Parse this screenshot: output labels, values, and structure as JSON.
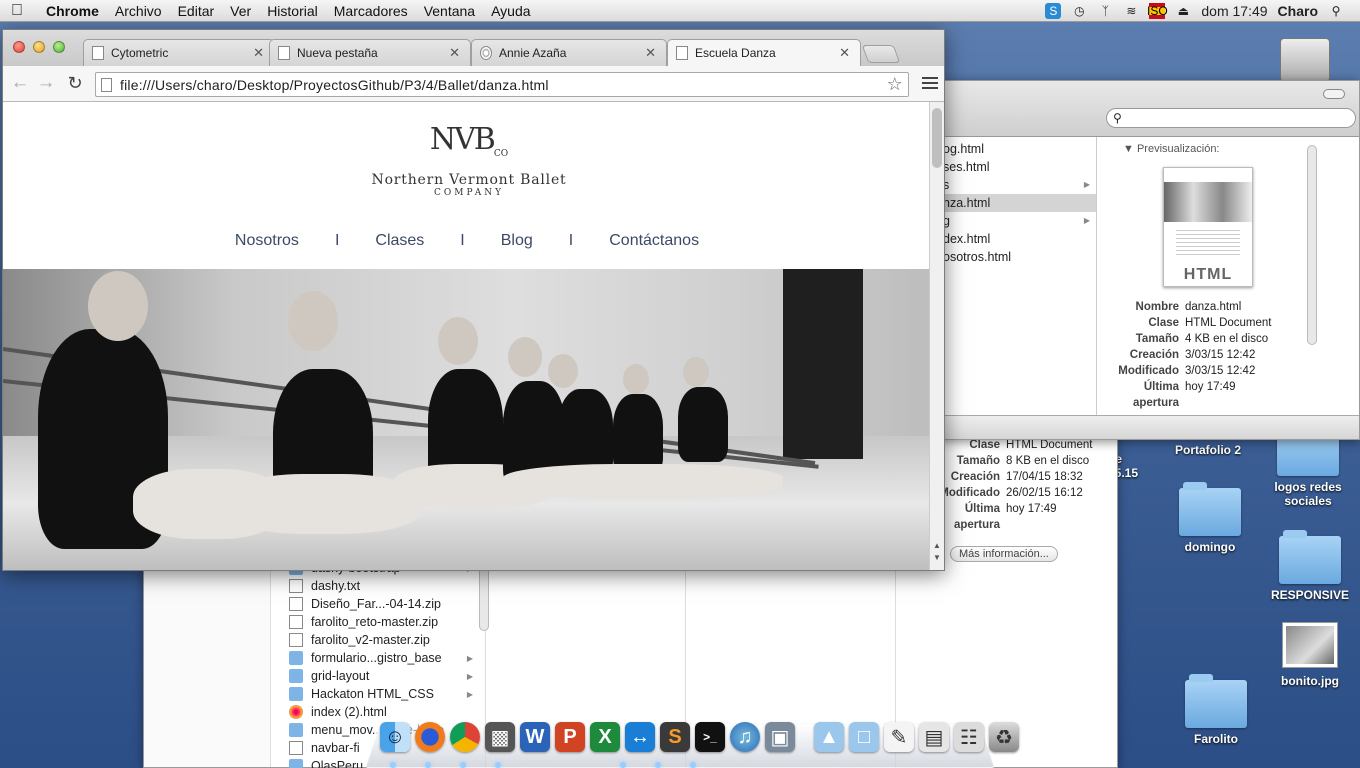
{
  "menubar": {
    "app": "Chrome",
    "items": [
      "Archivo",
      "Editar",
      "Ver",
      "Historial",
      "Marcadores",
      "Ventana",
      "Ayuda"
    ],
    "flag_text": "ISO",
    "clock": "dom 17:49",
    "user": "Charo"
  },
  "chrome": {
    "tabs": [
      {
        "title": "Cytometric",
        "icon": "page-icon"
      },
      {
        "title": "Nueva pestaña",
        "icon": "page-icon"
      },
      {
        "title": "Annie Azaña",
        "icon": "gear-icon"
      },
      {
        "title": "Escuela Danza",
        "icon": "page-icon",
        "active": true
      }
    ],
    "url": "file:///Users/charo/Desktop/ProyectosGithub/P3/4/Ballet/danza.html"
  },
  "site": {
    "logo_mark": "NVB",
    "logo_mark_small": "CO",
    "logo_name": "Northern Vermont Ballet",
    "logo_sub": "COMPANY",
    "nav": [
      "Nosotros",
      "Clases",
      "Blog",
      "Contáctanos"
    ],
    "nav_separator": "I"
  },
  "finder_top": {
    "files": [
      {
        "name": "og.html",
        "folder": false,
        "selected": false
      },
      {
        "name": "ses.html",
        "folder": false,
        "selected": false
      },
      {
        "name": "s",
        "folder": true,
        "selected": false
      },
      {
        "name": "nza.html",
        "folder": false,
        "selected": true
      },
      {
        "name": "g",
        "folder": true,
        "selected": false
      },
      {
        "name": "dex.html",
        "folder": false,
        "selected": false
      },
      {
        "name": "osotros.html",
        "folder": false,
        "selected": false
      }
    ],
    "preview_label": "Previsualización:",
    "thumb_badge": "HTML",
    "info": [
      {
        "k": "Nombre",
        "v": "danza.html"
      },
      {
        "k": "Clase",
        "v": "HTML Document"
      },
      {
        "k": "Tamaño",
        "v": "4 KB en el disco"
      },
      {
        "k": "Creación",
        "v": "3/03/15 12:42"
      },
      {
        "k": "Modificado",
        "v": "3/03/15 12:42"
      },
      {
        "k": "Última apertura",
        "v": "hoy 17:49"
      }
    ]
  },
  "finder_back": {
    "files": [
      {
        "name": "dashy-bootstrap",
        "kind": "folder"
      },
      {
        "name": "dashy.txt",
        "kind": "doc"
      },
      {
        "name": "Diseño_Far...-04-14.zip",
        "kind": "doc"
      },
      {
        "name": "farolito_reto-master.zip",
        "kind": "doc"
      },
      {
        "name": "farolito_v2-master.zip",
        "kind": "doc"
      },
      {
        "name": "formulario...gistro_base",
        "kind": "folder"
      },
      {
        "name": "grid-layout",
        "kind": "folder"
      },
      {
        "name": "Hackaton HTML_CSS",
        "kind": "folder"
      },
      {
        "name": "index (2).html",
        "kind": "html"
      },
      {
        "name": "menu_mov...gable-base",
        "kind": "folder"
      },
      {
        "name": "navbar-fi",
        "kind": "doc"
      },
      {
        "name": "OlasPeru",
        "kind": "folder"
      }
    ],
    "info": [
      {
        "k": "Clase",
        "v": "HTML Document"
      },
      {
        "k": "Tamaño",
        "v": "8 KB en el disco"
      },
      {
        "k": "Creación",
        "v": "17/04/15 18:32"
      },
      {
        "k": "Modificado",
        "v": "26/02/15 16:12"
      },
      {
        "k": "Última apertura",
        "v": "hoy 17:49"
      }
    ],
    "more_button": "Más información..."
  },
  "desktop": [
    {
      "label": "Portafolio 2",
      "kind": "folder"
    },
    {
      "label": "logos redes sociales",
      "kind": "folder"
    },
    {
      "label": "domingo",
      "kind": "folder"
    },
    {
      "label": "RESPONSIVE",
      "kind": "folder"
    },
    {
      "label": "bonito.jpg",
      "kind": "image"
    },
    {
      "label": "Farolito",
      "kind": "folder"
    },
    {
      "label": "de 45.15",
      "kind": "text"
    }
  ],
  "dock": [
    "finder",
    "firefox",
    "chrome",
    "preview",
    "word",
    "powerpoint",
    "excel",
    "teamviewer",
    "sublime",
    "terminal",
    "itunes",
    "photos",
    "applications",
    "documents",
    "textedit",
    "preview-doc",
    "finder-window",
    "chrome-window",
    "trash"
  ]
}
